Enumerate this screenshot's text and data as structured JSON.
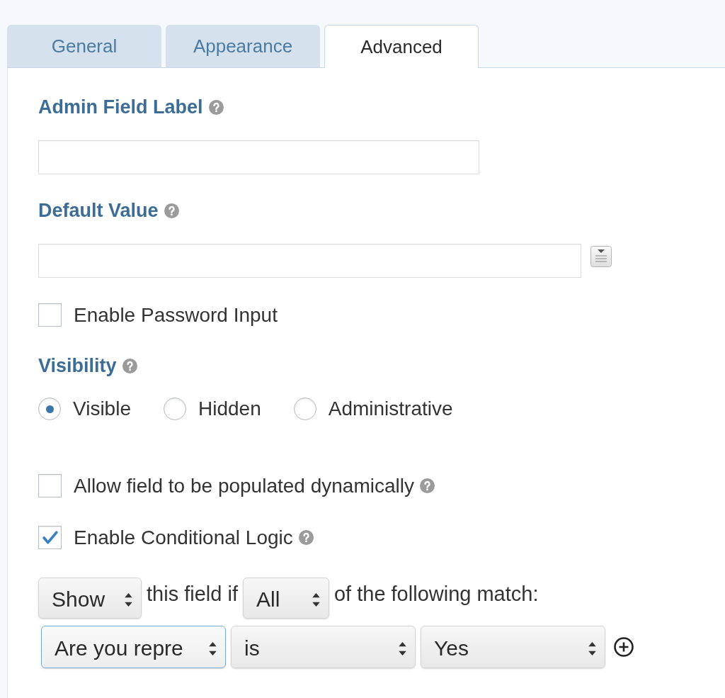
{
  "tabs": [
    {
      "label": "General",
      "selected": false
    },
    {
      "label": "Appearance",
      "selected": false
    },
    {
      "label": "Advanced",
      "selected": true
    }
  ],
  "sections": [
    {
      "kind": "text",
      "label": "Admin Field Label",
      "help_icon": true,
      "merge_tag_button": false
    },
    {
      "kind": "text",
      "label": "Default Value",
      "help_icon": true,
      "merge_tag_button": true
    },
    {
      "kind": "checkbox",
      "label": "Enable Password Input",
      "checked": false,
      "help_icon": false
    },
    {
      "kind": "radio_group",
      "label": "Visibility",
      "help_icon": true,
      "options": [
        {
          "label": "Visible",
          "selected": true
        },
        {
          "label": "Hidden",
          "selected": false
        },
        {
          "label": "Administrative",
          "selected": false
        }
      ]
    },
    {
      "kind": "checkbox",
      "label": "Allow field to be populated dynamically",
      "checked": false,
      "help_icon": true
    },
    {
      "kind": "checkbox",
      "label": "Enable Conditional Logic",
      "checked": true,
      "help_icon": true
    },
    {
      "kind": "conditional_logic",
      "action": "Show",
      "text_before": "this field if",
      "logic_type": "All",
      "text_after": "of the following match:",
      "rules": [
        {
          "field": "Are you repre",
          "operator": "is",
          "value": "Yes",
          "focused": true
        }
      ]
    }
  ]
}
